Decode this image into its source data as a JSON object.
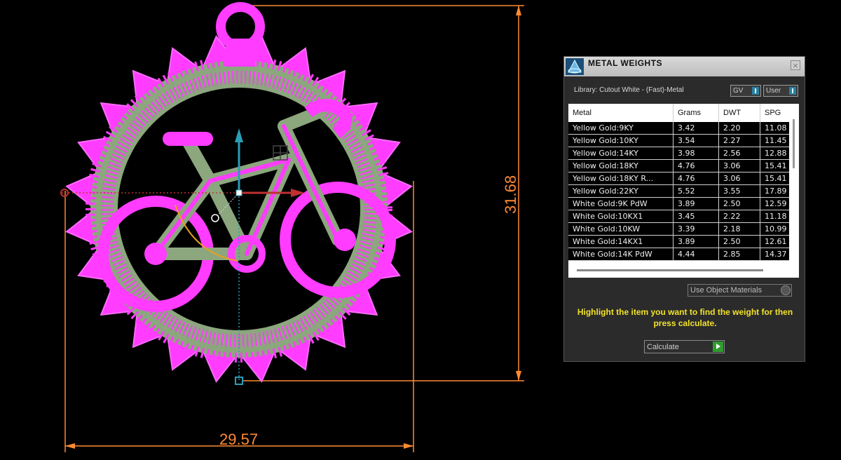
{
  "viewport": {
    "dimension_width": "29.57",
    "dimension_height": "31.68"
  },
  "colors": {
    "model": "#ff3cff",
    "model_fill": "#8ca67e",
    "dimension": "#ff8a33",
    "gizmo_axis": "#2a9db8",
    "instruction_text": "#f2e22a"
  },
  "panel": {
    "title": "METAL WEIGHTS",
    "close_icon": "×",
    "library_label": "Library: Cutout White - (Fast)-Metal",
    "gv_label": "GV",
    "user_label": "User",
    "columns": [
      "Metal",
      "Grams",
      "DWT",
      "SPG"
    ],
    "rows": [
      [
        "Yellow Gold:9KY",
        "3.42",
        "2.20",
        "11.08"
      ],
      [
        "Yellow Gold:10KY",
        "3.54",
        "2.27",
        "11.45"
      ],
      [
        "Yellow Gold:14KY",
        "3.98",
        "2.56",
        "12.88"
      ],
      [
        "Yellow Gold:18KY",
        "4.76",
        "3.06",
        "15.41"
      ],
      [
        "Yellow Gold:18KY R...",
        "4.76",
        "3.06",
        "15.41"
      ],
      [
        "Yellow Gold:22KY",
        "5.52",
        "3.55",
        "17.89"
      ],
      [
        "White Gold:9K PdW",
        "3.89",
        "2.50",
        "12.59"
      ],
      [
        "White Gold:10KX1",
        "3.45",
        "2.22",
        "11.18"
      ],
      [
        "White Gold:10KW",
        "3.39",
        "2.18",
        "10.99"
      ],
      [
        "White Gold:14KX1",
        "3.89",
        "2.50",
        "12.61"
      ],
      [
        "White Gold:14K PdW",
        "4.44",
        "2.85",
        "14.37"
      ]
    ],
    "materials_option": "Use Object Materials",
    "instructions": "Highlight the item you want to find the weight for then press calculate.",
    "calculate_label": "Calculate"
  }
}
